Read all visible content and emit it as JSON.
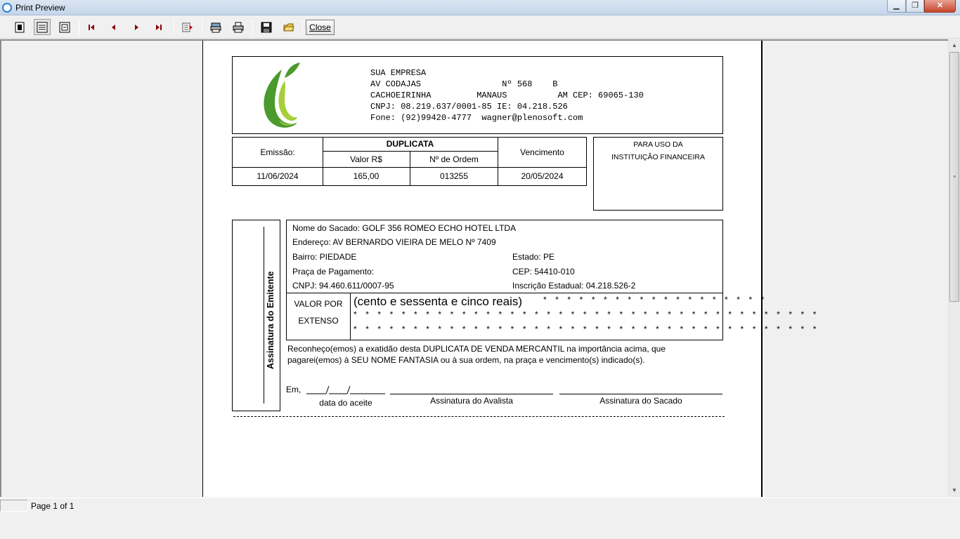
{
  "window": {
    "title": "Print Preview"
  },
  "toolbar": {
    "close_label": "Close"
  },
  "status": {
    "page": "Page 1 of 1"
  },
  "company": {
    "lines": [
      "SUA EMPRESA",
      "AV CODAJAS                Nº 568    B",
      "CACHOEIRINHA         MANAUS          AM CEP: 69065-130",
      "CNPJ: 08.219.637/0001-85 IE: 04.218.526",
      "Fone: (92)99420-4777  wagner@plenosoft.com"
    ]
  },
  "duplicata": {
    "emissao_label": "Emissão:",
    "title": "DUPLICATA",
    "valor_label": "Valor R$",
    "ordem_label": "Nº de Ordem",
    "vencimento_label": "Vencimento",
    "emissao": "11/06/2024",
    "valor": "165,00",
    "ordem": "013255",
    "vencimento": "20/05/2024"
  },
  "instituicao": {
    "line1": "PARA USO DA",
    "line2": "INSTITUIÇÃO FINANCEIRA"
  },
  "emitente": {
    "label": "Assinatura do Emitente"
  },
  "sacado": {
    "nome": "Nome do Sacado: GOLF 356 ROMEO ECHO HOTEL LTDA",
    "endereco": "Endereço: AV BERNARDO VIEIRA DE MELO Nº 7409",
    "bairro": "Bairro: PIEDADE",
    "estado": "Estado: PE",
    "praca": "Praça de Pagamento:",
    "cep": "CEP: 54410-010",
    "cnpj": "CNPJ: 94.460.611/0007-95",
    "ie": "Inscrição Estadual: 04.218.526-2"
  },
  "extenso": {
    "label1": "VALOR POR",
    "label2": "EXTENSO",
    "text": "(cento e sessenta e cinco reais)",
    "stars1": "* * * * * * * * * * * * * * * * * * *",
    "stars2": "* * * * * * * * * * * * * * * * * * * * * * * * * * * * * * * * * * * * * * *",
    "stars3": "* * * * * * * * * * * * * * * * * * * * * * * * * * * * * * * * * * * * * * *"
  },
  "declaracao": {
    "line1": "Reconheço(emos) a exatidão desta DUPLICATA DE VENDA MERCANTIL na importância acima, que",
    "line2": "pagarei(emos) à SEU NOME FANTASIA ou à sua ordem, na praça e vencimento(s) indicado(s)."
  },
  "assinaturas": {
    "em": "Em,",
    "data_aceite": "data do aceite",
    "avalista": "Assinatura do Avalista",
    "sacado": "Assinatura do Sacado"
  },
  "colors": {
    "logo_green_dark": "#4a9a2e",
    "logo_green_light": "#a6cf3a"
  }
}
